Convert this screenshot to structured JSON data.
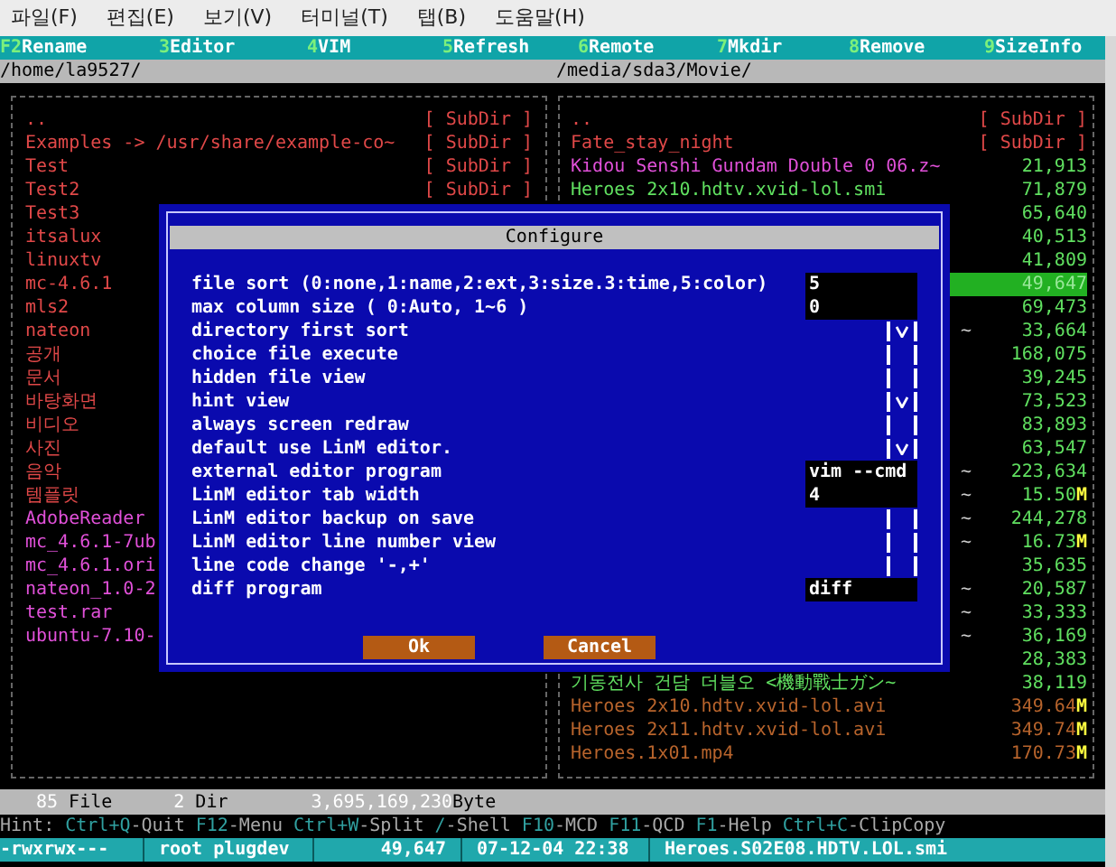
{
  "menu": [
    "파일(F)",
    "편집(E)",
    "보기(V)",
    "터미널(T)",
    "탭(B)",
    "도움말(H)"
  ],
  "function_keys": [
    {
      "key": "F2",
      "label": "Rename"
    },
    {
      "key": "3",
      "label": "Editor"
    },
    {
      "key": "4",
      "label": "VIM"
    },
    {
      "key": "5",
      "label": "Refresh"
    },
    {
      "key": "6",
      "label": "Remote"
    },
    {
      "key": "7",
      "label": "Mkdir"
    },
    {
      "key": "8",
      "label": "Remove"
    },
    {
      "key": "9",
      "label": "SizeInfo"
    }
  ],
  "left_panel": {
    "path": "/home/la9527/",
    "rows": [
      {
        "name": "..",
        "tag": "[ SubDir ]",
        "kind": "dir"
      },
      {
        "name": "Examples -> /usr/share/example-co~",
        "tag": "[ SubDir ]",
        "kind": "dir"
      },
      {
        "name": "Test",
        "tag": "[ SubDir ]",
        "kind": "dir"
      },
      {
        "name": "Test2",
        "tag": "[ SubDir ]",
        "kind": "dir"
      },
      {
        "name": "Test3",
        "kind": "dir"
      },
      {
        "name": "itsalux",
        "kind": "dir"
      },
      {
        "name": "linuxtv",
        "kind": "dir"
      },
      {
        "name": "mc-4.6.1",
        "kind": "dir"
      },
      {
        "name": "mls2",
        "kind": "dir"
      },
      {
        "name": "nateon",
        "kind": "dir"
      },
      {
        "name": "공개",
        "kind": "dir"
      },
      {
        "name": "문서",
        "kind": "dir"
      },
      {
        "name": "바탕화면",
        "kind": "dir"
      },
      {
        "name": "비디오",
        "kind": "dir"
      },
      {
        "name": "사진",
        "kind": "dir"
      },
      {
        "name": "음악",
        "kind": "dir"
      },
      {
        "name": "템플릿",
        "kind": "dir"
      },
      {
        "name": "AdobeReader",
        "kind": "archive"
      },
      {
        "name": "mc_4.6.1-7ub",
        "kind": "archive"
      },
      {
        "name": "mc_4.6.1.ori",
        "kind": "archive"
      },
      {
        "name": "nateon_1.0-2",
        "kind": "archive"
      },
      {
        "name": "test.rar",
        "kind": "archive"
      },
      {
        "name": "ubuntu-7.10-",
        "kind": "archive"
      }
    ]
  },
  "right_panel": {
    "path": "/media/sda3/Movie/",
    "rows": [
      {
        "name": "..",
        "size": "[ SubDir ]",
        "kind": "dir",
        "selected": false
      },
      {
        "name": "Fate_stay_night",
        "size": "[ SubDir ]",
        "kind": "dir",
        "selected": false
      },
      {
        "name": "Kidou Senshi Gundam Double 0 06.z~",
        "size": "21,913",
        "kind": "archive",
        "selected": false
      },
      {
        "name": "Heroes 2x10.hdtv.xvid-lol.smi",
        "size": "71,879",
        "kind": "text",
        "selected": false
      },
      {
        "size": "65,640",
        "kind": "text",
        "selected": false
      },
      {
        "size": "40,513",
        "kind": "text",
        "selected": false
      },
      {
        "size": "41,809",
        "kind": "text",
        "selected": false
      },
      {
        "size": "49,647",
        "selected": true
      },
      {
        "size": "69,473",
        "kind": "text",
        "selected": false
      },
      {
        "tail": "~",
        "size": "33,664",
        "kind": "text",
        "selected": false
      },
      {
        "size": "168,075",
        "kind": "text",
        "selected": false
      },
      {
        "size": "39,245",
        "kind": "text",
        "selected": false
      },
      {
        "size": "73,523",
        "kind": "text",
        "selected": false
      },
      {
        "size": "83,893",
        "kind": "text",
        "selected": false
      },
      {
        "size": "63,547",
        "kind": "text",
        "selected": false
      },
      {
        "tail": "~",
        "size": "223,634",
        "kind": "text",
        "selected": false
      },
      {
        "tail": "~",
        "size": "15.50",
        "unit": "M",
        "kind": "text",
        "selected": false
      },
      {
        "tail": "~",
        "size": "244,278",
        "kind": "text",
        "selected": false
      },
      {
        "tail": "~",
        "size": "16.73",
        "unit": "M",
        "kind": "text",
        "selected": false
      },
      {
        "size": "35,635",
        "kind": "text",
        "selected": false
      },
      {
        "tail": "~",
        "size": "20,587",
        "kind": "text",
        "selected": false
      },
      {
        "tail": "~",
        "size": "33,333",
        "kind": "text",
        "selected": false
      },
      {
        "tail": "~",
        "size": "36,169",
        "kind": "text",
        "selected": false
      },
      {
        "size": "28,383",
        "kind": "text",
        "selected": false
      },
      {
        "name": "기동전사 건담 더블오 <機動戰士ガン~",
        "size": "38,119",
        "kind": "text",
        "selected": false
      },
      {
        "name": "Heroes 2x10.hdtv.xvid-lol.avi",
        "size": "349.64",
        "unit": "M",
        "kind": "video",
        "selected": false
      },
      {
        "name": "Heroes 2x11.hdtv.xvid-lol.avi",
        "size": "349.74",
        "unit": "M",
        "kind": "video",
        "selected": false
      },
      {
        "name": "Heroes.1x01.mp4",
        "size": "170.73",
        "unit": "M",
        "kind": "video",
        "selected": false
      }
    ]
  },
  "dialog": {
    "title": "Configure",
    "options": [
      {
        "label": "file sort (0:none,1:name,2:ext,3:size.3:time,5:color)",
        "kind": "value",
        "value": "5"
      },
      {
        "label": "max column size ( 0:Auto, 1~6 )",
        "kind": "value",
        "value": "0"
      },
      {
        "label": "directory first sort",
        "kind": "checkbox",
        "checked": true
      },
      {
        "label": "choice file execute",
        "kind": "checkbox",
        "checked": false
      },
      {
        "label": "hidden file view",
        "kind": "checkbox",
        "checked": false
      },
      {
        "label": "hint view",
        "kind": "checkbox",
        "checked": true
      },
      {
        "label": "always screen redraw",
        "kind": "checkbox",
        "checked": false
      },
      {
        "label": "default use LinM editor.",
        "kind": "checkbox",
        "checked": true
      },
      {
        "label": "external editor program",
        "kind": "value",
        "value": "vim --cmd"
      },
      {
        "label": "LinM editor tab width",
        "kind": "value",
        "value": "4"
      },
      {
        "label": "LinM editor backup on save",
        "kind": "checkbox",
        "checked": false
      },
      {
        "label": "LinM editor line number view",
        "kind": "checkbox",
        "checked": false
      },
      {
        "label": "line code change '-,+'",
        "kind": "checkbox",
        "checked": false
      },
      {
        "label": "diff program",
        "kind": "value",
        "value": "diff"
      }
    ],
    "buttons": [
      "Ok",
      "Cancel"
    ]
  },
  "panel_status": {
    "files_count": "85",
    "files_label": "File",
    "dirs_count": "2",
    "dirs_label": "Dir",
    "bytes": "3,695,169,230",
    "bytes_label": "Byte"
  },
  "hint": {
    "label": "Hint:",
    "items": [
      {
        "key": "Ctrl+Q",
        "action": "-Quit"
      },
      {
        "key": "F12",
        "action": "-Menu"
      },
      {
        "key": "Ctrl+W",
        "action": "-Split"
      },
      {
        "key": "/",
        "action": "-Shell"
      },
      {
        "key": "F10",
        "action": "-MCD"
      },
      {
        "key": "F11",
        "action": "-QCD"
      },
      {
        "key": "F1",
        "action": "-Help"
      },
      {
        "key": "Ctrl+C",
        "action": "-ClipCopy"
      }
    ]
  },
  "file_info": {
    "permissions": "-rwxrwx---",
    "owner": "root plugdev",
    "size": "49,647",
    "date": "07-12-04 22:38",
    "name": "Heroes.S02E08.HDTV.LOL.smi"
  }
}
